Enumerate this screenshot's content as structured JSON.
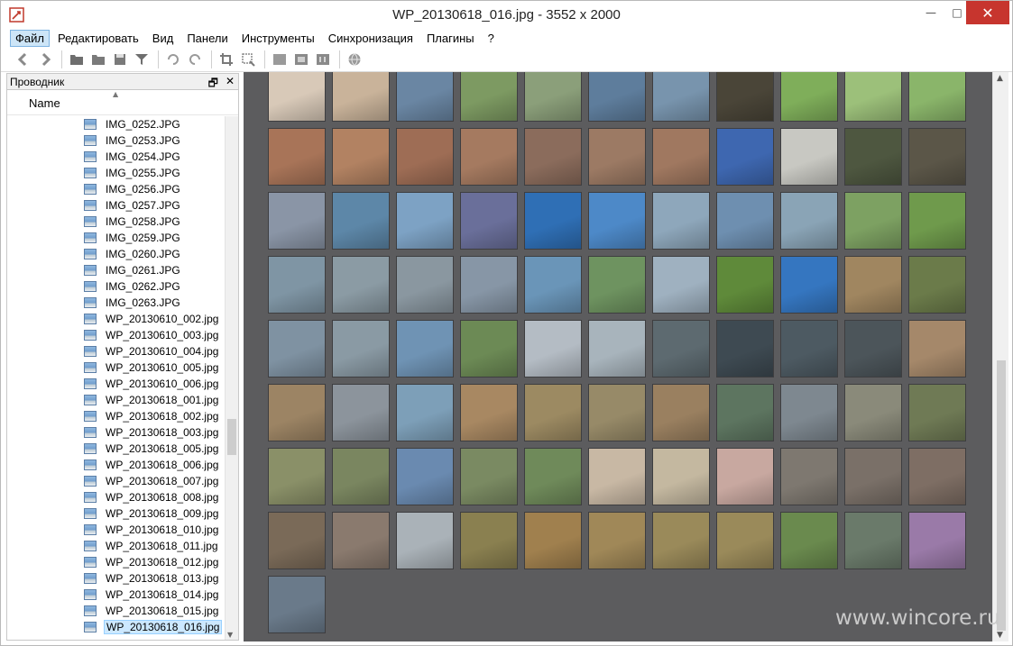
{
  "window": {
    "title": "WP_20130618_016.jpg  - 3552 x 2000",
    "minimize_glyph": "—",
    "maximize_glyph": "□",
    "close_glyph": "✕"
  },
  "menu": {
    "items": [
      "Файл",
      "Редактировать",
      "Вид",
      "Панели",
      "Инструменты",
      "Синхронизация",
      "Плагины",
      "?"
    ],
    "active_index": 0
  },
  "toolbar": {
    "icons": [
      "back-arrow-icon",
      "forward-arrow-icon",
      "folder-open-icon",
      "folder-icon",
      "save-icon",
      "filter-icon",
      "rotate-left-icon",
      "rotate-right-icon",
      "crop-icon",
      "resize-icon",
      "fit-screen-icon",
      "fullscreen-icon",
      "actual-size-icon",
      "web-globe-icon"
    ]
  },
  "explorer": {
    "title": "Проводник",
    "pin_glyph": "🗗",
    "close_glyph": "✕",
    "column_name": "Name",
    "files": [
      "IMG_0252.JPG",
      "IMG_0253.JPG",
      "IMG_0254.JPG",
      "IMG_0255.JPG",
      "IMG_0256.JPG",
      "IMG_0257.JPG",
      "IMG_0258.JPG",
      "IMG_0259.JPG",
      "IMG_0260.JPG",
      "IMG_0261.JPG",
      "IMG_0262.JPG",
      "IMG_0263.JPG",
      "WP_20130610_002.jpg",
      "WP_20130610_003.jpg",
      "WP_20130610_004.jpg",
      "WP_20130610_005.jpg",
      "WP_20130610_006.jpg",
      "WP_20130618_001.jpg",
      "WP_20130618_002.jpg",
      "WP_20130618_003.jpg",
      "WP_20130618_005.jpg",
      "WP_20130618_006.jpg",
      "WP_20130618_007.jpg",
      "WP_20130618_008.jpg",
      "WP_20130618_009.jpg",
      "WP_20130618_010.jpg",
      "WP_20130618_011.jpg",
      "WP_20130618_012.jpg",
      "WP_20130618_013.jpg",
      "WP_20130618_014.jpg",
      "WP_20130618_015.jpg",
      "WP_20130618_016.jpg"
    ],
    "selected_file": "WP_20130618_016.jpg"
  },
  "thumbnails": {
    "colors": [
      [
        "#d8c9b8",
        "#c9b39a",
        "#6a86a3",
        "#7d9a62",
        "#8b9f7a",
        "#5e7d9c",
        "#7894ad",
        "#4a4538",
        "#7fae5a",
        "#9cc07a",
        "#8ab56a"
      ],
      [
        "#a87458",
        "#b28262",
        "#9e6d55",
        "#a57a60",
        "#8b6c5c",
        "#9c7a64",
        "#a07860",
        "#3e67b0",
        "#c8c8c2",
        "#4e5740",
        "#5b5648"
      ],
      [
        "#8a95a6",
        "#5d87a8",
        "#7da2c4",
        "#6a6f9a",
        "#2f6fb5",
        "#4d89c8",
        "#8ea7bb",
        "#6e8fb0",
        "#8aa4b6",
        "#7da162",
        "#6f9a4c"
      ],
      [
        "#7f95a4",
        "#8b9ba4",
        "#8a97a0",
        "#8796a6",
        "#6a95b8",
        "#6e9360",
        "#9fb1c0",
        "#5f8a3a",
        "#3576c0",
        "#a08660",
        "#6b7b4a"
      ],
      [
        "#7f92a2",
        "#8a9aa4",
        "#6f93b4",
        "#6c8a55",
        "#b4bcc4",
        "#a8b4bc",
        "#5d6a70",
        "#3e4a52",
        "#4d5a62",
        "#4c555a",
        "#a5886a"
      ],
      [
        "#9c8464",
        "#8c949c",
        "#7d9fb8",
        "#a88862",
        "#9c8a62",
        "#978a68",
        "#9a8060",
        "#5d7560",
        "#7e8890",
        "#8a8a7a",
        "#6f7a55"
      ],
      [
        "#8a9068",
        "#7a8660",
        "#6a8ab0",
        "#7a8a62",
        "#6f8a5a",
        "#c8b8a4",
        "#c4b8a0",
        "#c8a8a0",
        "#7e7870",
        "#7a7068",
        "#7e6e64"
      ],
      [
        "#7a6a58",
        "#8a7a6e",
        "#aab2b8",
        "#8a8050",
        "#a0804e",
        "#a08858",
        "#9a8a5a",
        "#9a8a5a",
        "#6a8a4e",
        "#6a7a6a",
        "#9a7aa8"
      ],
      [
        "#6a7a8a"
      ]
    ]
  }
}
